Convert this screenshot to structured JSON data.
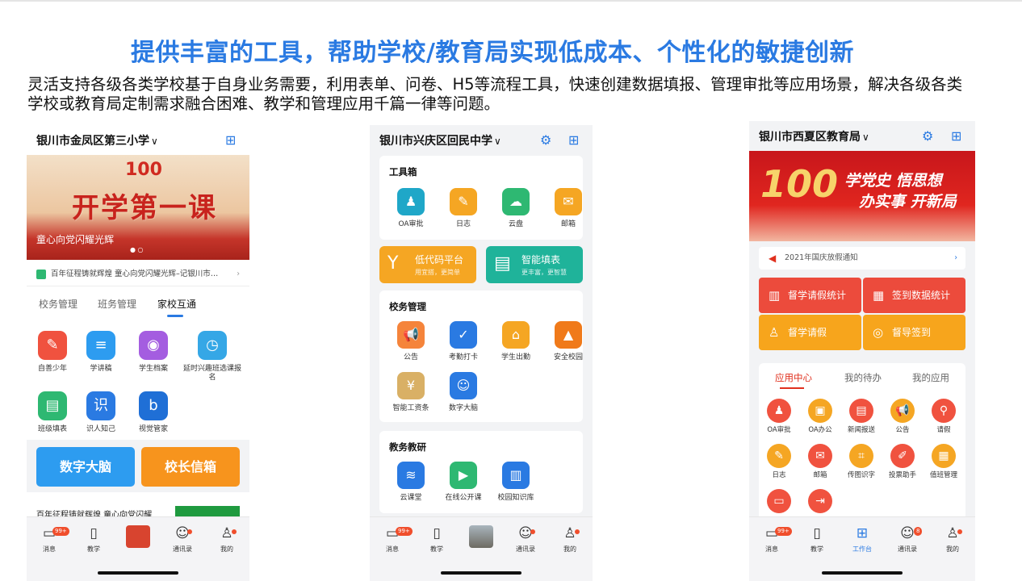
{
  "title": "提供丰富的工具，帮助学校/教育局实现低成本、个性化的敏捷创新",
  "description": "灵活支持各级各类学校基于自身业务需要，利用表单、问卷、H5等流程工具，快速创建数据填报、管理审批等应用场景，解决各级各类学校或教育局定制需求融合困难、教学和管理应用千篇一律等问题。",
  "phone1": {
    "school": "银川市金凤区第三小学",
    "banner_title": "开学第一课",
    "banner_hundred": "100",
    "banner_sub": "童心向党闪耀光辉",
    "notice": "百年征程铸就辉煌 童心向党闪耀光辉–记银川市…",
    "tabs": [
      "校务管理",
      "班务管理",
      "家校互通"
    ],
    "apps": [
      {
        "label": "自善少年",
        "color": "#f0523f",
        "glyph": "✎"
      },
      {
        "label": "学讲稿",
        "color": "#2d9cf0",
        "glyph": "≡"
      },
      {
        "label": "学生档案",
        "color": "#a45de0",
        "glyph": "◉"
      },
      {
        "label": "延时兴趣班选课报名",
        "color": "#35a7e6",
        "glyph": "◷"
      },
      {
        "label": "班级填表",
        "color": "#2eb872",
        "glyph": "▤"
      },
      {
        "label": "识人知己",
        "color": "#2a7ae2",
        "glyph": "识"
      },
      {
        "label": "视觉管家",
        "color": "#1f6fd6",
        "glyph": "b"
      }
    ],
    "big_buttons": [
      "数字大脑",
      "校长信箱"
    ],
    "news": "百年征程铸就辉煌 童心向党闪耀"
  },
  "phone2": {
    "school": "银川市兴庆区回民中学",
    "toolbox_title": "工具箱",
    "toolbox": [
      {
        "label": "OA审批",
        "color": "#1fa7c8",
        "glyph": "♟"
      },
      {
        "label": "日志",
        "color": "#f5a623",
        "glyph": "✎"
      },
      {
        "label": "云盘",
        "color": "#2eb872",
        "glyph": "☁"
      },
      {
        "label": "邮箱",
        "color": "#f5a623",
        "glyph": "✉"
      }
    ],
    "pill_low_title": "低代码平台",
    "pill_low_sub": "用宜搭，更简单",
    "pill_smart_title": "智能填表",
    "pill_smart_sub": "更丰富，更智慧",
    "school_mgmt_title": "校务管理",
    "school_mgmt": [
      {
        "label": "公告",
        "color": "#f5843b",
        "glyph": "📢"
      },
      {
        "label": "考勤打卡",
        "color": "#2a7ae2",
        "glyph": "✓"
      },
      {
        "label": "学生出勤",
        "color": "#f5a623",
        "glyph": "⌂"
      },
      {
        "label": "安全校园",
        "color": "#f07a1a",
        "glyph": "▲"
      },
      {
        "label": "智能工资条",
        "color": "#d9b065",
        "glyph": "¥"
      },
      {
        "label": "数字大脑",
        "color": "#2a7ae2",
        "glyph": "☺"
      }
    ],
    "teach_title": "教务教研",
    "teach": [
      {
        "label": "云课堂",
        "color": "#2a7ae2",
        "glyph": "≋"
      },
      {
        "label": "在线公开课",
        "color": "#2eb872",
        "glyph": "▶"
      },
      {
        "label": "校园知识库",
        "color": "#2a7ae2",
        "glyph": "▥"
      }
    ]
  },
  "phone3": {
    "school": "银川市西夏区教育局",
    "banner_line1": "学党史 悟思想",
    "banner_line2": "办实事 开新局",
    "banner_hundred": "100",
    "notice": "2021年国庆放假通知",
    "red_buttons": [
      "督学请假统计",
      "签到数据统计"
    ],
    "orange_buttons": [
      "督学请假",
      "督导签到"
    ],
    "tabs": [
      "应用中心",
      "我的待办",
      "我的应用"
    ],
    "apps": [
      {
        "label": "OA审批",
        "color": "#f0523f",
        "glyph": "♟"
      },
      {
        "label": "OA办公",
        "color": "#f5a623",
        "glyph": "▣"
      },
      {
        "label": "新闻报送",
        "color": "#f0523f",
        "glyph": "▤"
      },
      {
        "label": "公告",
        "color": "#f5a623",
        "glyph": "📢"
      },
      {
        "label": "请假",
        "color": "#f0523f",
        "glyph": "⚲"
      },
      {
        "label": "日志",
        "color": "#f5a623",
        "glyph": "✎"
      },
      {
        "label": "邮箱",
        "color": "#f0523f",
        "glyph": "✉"
      },
      {
        "label": "传图识字",
        "color": "#f5a623",
        "glyph": "⌗"
      },
      {
        "label": "投票助手",
        "color": "#f0523f",
        "glyph": "✐"
      },
      {
        "label": "值班管理",
        "color": "#f5a623",
        "glyph": "▦"
      },
      {
        "label": "",
        "color": "#f0523f",
        "glyph": "▭"
      },
      {
        "label": "",
        "color": "#f0523f",
        "glyph": "⇥"
      }
    ]
  },
  "tabbar": {
    "messages": "消息",
    "teaching": "教学",
    "contacts": "通讯录",
    "mine": "我的",
    "workbench": "工作台",
    "badge": "99+",
    "contact_badge": "8"
  }
}
